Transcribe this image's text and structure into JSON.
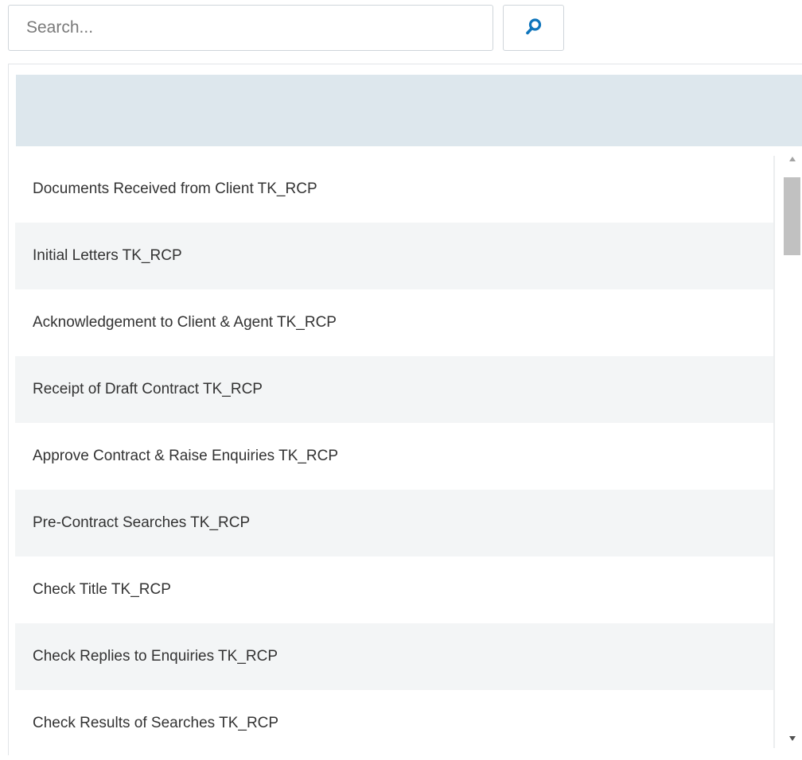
{
  "search": {
    "placeholder": "Search...",
    "value": "",
    "button_icon": "search-icon",
    "accent_color": "#0f75bc"
  },
  "panel": {
    "header_color": "#dde7ed"
  },
  "list": {
    "items": [
      {
        "label": "Documents Received from Client TK_RCP"
      },
      {
        "label": "Initial Letters TK_RCP"
      },
      {
        "label": "Acknowledgement to Client & Agent TK_RCP"
      },
      {
        "label": "Receipt of Draft Contract TK_RCP"
      },
      {
        "label": "Approve Contract & Raise Enquiries TK_RCP"
      },
      {
        "label": "Pre-Contract Searches TK_RCP"
      },
      {
        "label": "Check Title TK_RCP"
      },
      {
        "label": "Check Replies to Enquiries TK_RCP"
      },
      {
        "label": "Check Results of Searches TK_RCP"
      }
    ]
  },
  "scrollbar": {
    "up_icon": "triangle-up-icon",
    "down_icon": "triangle-down-icon"
  }
}
